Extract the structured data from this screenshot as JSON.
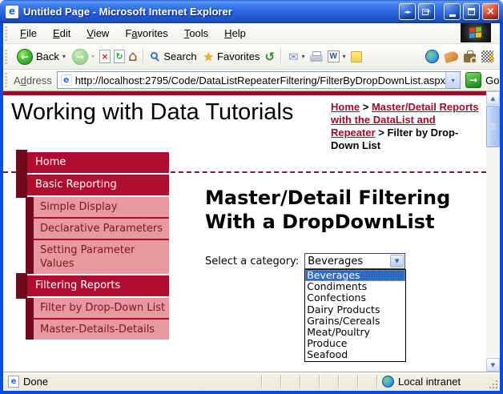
{
  "titlebar": {
    "title": "Untitled Page - Microsoft Internet Explorer"
  },
  "menubar": {
    "items": [
      {
        "label": "File",
        "accel": 0
      },
      {
        "label": "Edit",
        "accel": 0
      },
      {
        "label": "View",
        "accel": 0
      },
      {
        "label": "Favorites",
        "accel": 1
      },
      {
        "label": "Tools",
        "accel": 0
      },
      {
        "label": "Help",
        "accel": 0
      }
    ]
  },
  "toolbar": {
    "back_label": "Back",
    "search_label": "Search",
    "favorites_label": "Favorites"
  },
  "addressbar": {
    "label": "Address",
    "label_accel": 1,
    "url": "http://localhost:2795/Code/DataListRepeaterFiltering/FilterByDropDownList.aspx",
    "go_label": "Go"
  },
  "page": {
    "title": "Working with Data Tutorials",
    "breadcrumb": {
      "link1": "Home",
      "separator": ">",
      "link2": "Master/Detail Reports with the DataList and Repeater",
      "current": "Filter by Drop-Down List"
    },
    "sidebar": {
      "items": [
        {
          "label": "Home",
          "type": "header"
        },
        {
          "label": "Basic Reporting",
          "type": "header"
        },
        {
          "label": "Simple Display",
          "type": "sub"
        },
        {
          "label": "Declarative Parameters",
          "type": "sub"
        },
        {
          "label": "Setting Parameter Values",
          "type": "sub"
        },
        {
          "label": "Filtering Reports",
          "type": "header"
        },
        {
          "label": "Filter by Drop-Down List",
          "type": "sub"
        },
        {
          "label": "Master-Details-Details",
          "type": "sub"
        }
      ]
    },
    "main": {
      "heading_line1": "Master/Detail Filtering",
      "heading_line2": "With a DropDownList",
      "select_label": "Select a category:",
      "select_value": "Beverages",
      "selected_index": 0,
      "options": [
        "Beverages",
        "Condiments",
        "Confections",
        "Dairy Products",
        "Grains/Cereals",
        "Meat/Poultry",
        "Produce",
        "Seafood"
      ]
    }
  },
  "statusbar": {
    "status": "Done",
    "zone": "Local intranet"
  },
  "colors": {
    "crimson": "#b00d31",
    "dark_maroon": "#6f0b1d",
    "pink": "#e8989f",
    "pink_text": "#7c1626",
    "page_accent": "#9e0c2c",
    "selection_blue": "#316ac5",
    "titlebar_blue": "#2a64de",
    "frame_blue": "#0b4edb"
  },
  "icons": {
    "ie_letter": "e",
    "nav_switch": "◄►",
    "export_arrow": "→",
    "close": "×",
    "back_arrow": "←",
    "forward_arrow": "→",
    "dropdown_caret": "▾",
    "stop_cross": "×",
    "refresh_arrow": "↻",
    "home_glyph": "⌂",
    "star": "★",
    "history_arrow": "↺",
    "mail_envelope": "✉",
    "word_letter": "W",
    "go_arrow": "→",
    "scroll_up": "▲",
    "scroll_down": "▼",
    "combo_caret": "▼",
    "lightning": "ϟ"
  }
}
